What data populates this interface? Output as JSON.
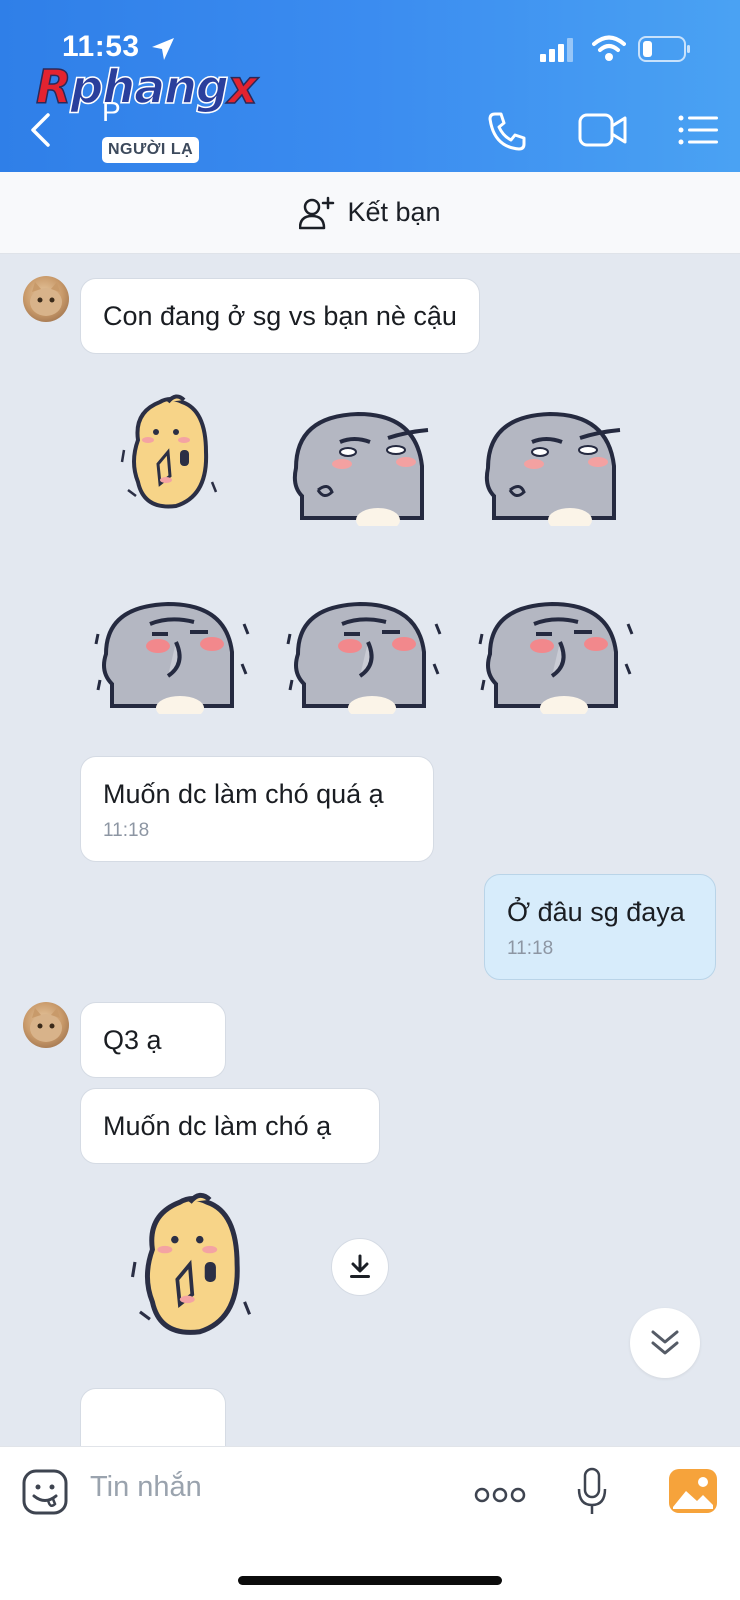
{
  "status_bar": {
    "time": "11:53"
  },
  "watermark": {
    "part1": "R",
    "part2": "phang",
    "part3": "x"
  },
  "header": {
    "contact_name": "P",
    "badge": "NGƯỜI LẠ",
    "icons": [
      "back-icon",
      "phone-icon",
      "video-call-icon",
      "menu-list-icon"
    ]
  },
  "friend_bar": {
    "label": "Kết bạn"
  },
  "messages": [
    {
      "text": "Con đang ở sg vs bạn nè cậu"
    },
    {
      "text": "Muốn dc làm chó quá ạ",
      "time": "11:18"
    },
    {
      "text": "Ở đâu sg đaya",
      "time": "11:18",
      "mine": true
    },
    {
      "text": "Q3 ạ"
    },
    {
      "text": "Muốn dc làm chó ạ"
    }
  ],
  "input": {
    "placeholder": "Tin nhắn"
  },
  "colors": {
    "header_start": "#2f7fe8",
    "header_end": "#4aa2f3",
    "chat_bg": "#e3e8f0",
    "mine_bubble": "#d7ecfb"
  }
}
